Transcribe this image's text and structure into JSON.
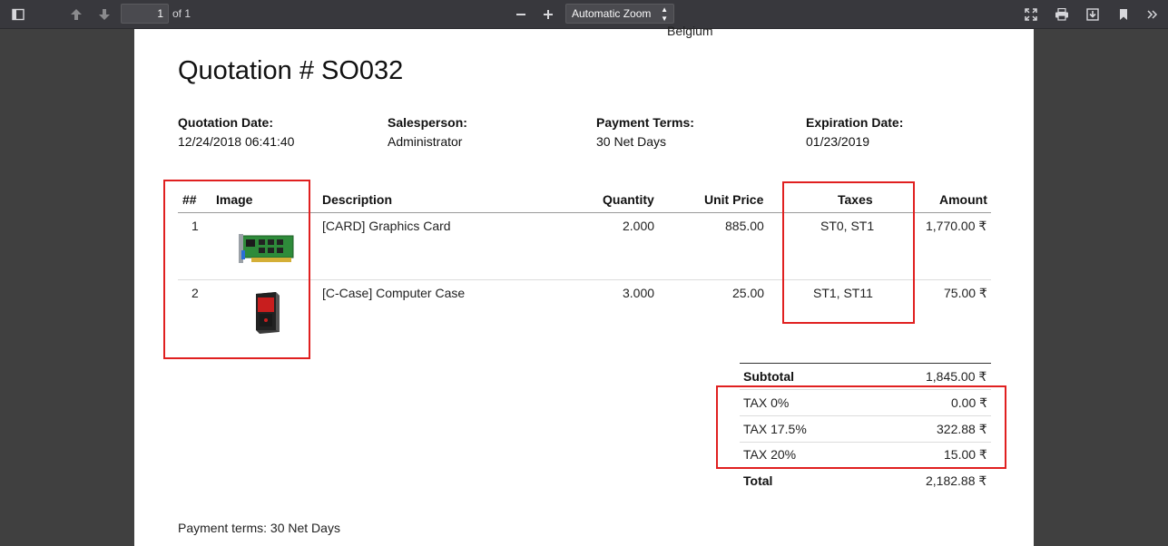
{
  "toolbar": {
    "page_number": "1",
    "page_count": "of 1",
    "zoom": "Automatic Zoom"
  },
  "document": {
    "address_tail": "Belgium",
    "title": "Quotation # SO032",
    "info": [
      {
        "label": "Quotation Date:",
        "value": "12/24/2018 06:41:40"
      },
      {
        "label": "Salesperson:",
        "value": "Administrator"
      },
      {
        "label": "Payment Terms:",
        "value": "30 Net Days"
      },
      {
        "label": "Expiration Date:",
        "value": "01/23/2019"
      }
    ],
    "table": {
      "headers": {
        "num": "##",
        "image": "Image",
        "description": "Description",
        "quantity": "Quantity",
        "unit_price": "Unit Price",
        "taxes": "Taxes",
        "amount": "Amount"
      },
      "rows": [
        {
          "num": "1",
          "image": "graphics-card-image",
          "description": "[CARD] Graphics Card",
          "quantity": "2.000",
          "unit_price": "885.00",
          "taxes": "ST0, ST1",
          "amount": "1,770.00 ₹"
        },
        {
          "num": "2",
          "image": "computer-case-image",
          "description": "[C-Case] Computer Case",
          "quantity": "3.000",
          "unit_price": "25.00",
          "taxes": "ST1, ST11",
          "amount": "75.00 ₹"
        }
      ]
    },
    "totals": [
      {
        "label": "Subtotal",
        "value": "1,845.00 ₹"
      },
      {
        "label": "TAX 0%",
        "value": "0.00 ₹"
      },
      {
        "label": "TAX 17.5%",
        "value": "322.88 ₹"
      },
      {
        "label": "TAX 20%",
        "value": "15.00 ₹"
      },
      {
        "label": "Total",
        "value": "2,182.88 ₹"
      }
    ],
    "footer_note": "Payment terms: 30 Net Days"
  },
  "colors": {
    "highlight": "#e02020",
    "toolbar": "#38383d",
    "viewer_bg": "#404040"
  }
}
